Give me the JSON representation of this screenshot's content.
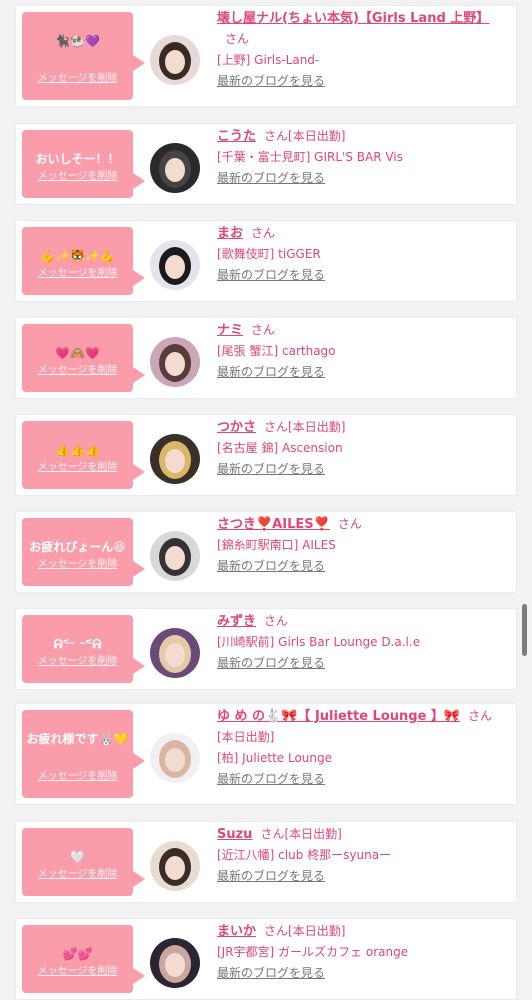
{
  "delete_label": "メッセージを削除",
  "san_label": "さん",
  "blog_label": "最新のブログを見る",
  "colors": {
    "bubble": "#fb9cab",
    "name": "#e0457b",
    "blog": "#777777",
    "background": "#f2f2f4"
  },
  "entries": [
    {
      "message": "🐈‍⬛🐏💜",
      "name": "壊し屋ナル(ちょい本気)【Girls Land 上野】",
      "status": "",
      "shop": "[上野] Girls-Land-",
      "avatar_icon": "girl-photo-icon"
    },
    {
      "message": "おいしそー！！",
      "name": "こうた",
      "status": "[本日出勤]",
      "shop": "[千葉・富士見町] GIRL'S BAR Vis",
      "avatar_icon": "dark-photo-icon"
    },
    {
      "message": "💪✨🐯✨💪",
      "name": "まお",
      "status": "",
      "shop": "[歌舞伎町] tiGGER",
      "avatar_icon": "girl-photo-icon"
    },
    {
      "message": "💗🙈💗",
      "name": "ナミ",
      "status": "",
      "shop": "[尾張 蟹江] carthago",
      "avatar_icon": "girl-photo-icon"
    },
    {
      "message": "👍👍👍",
      "name": "つかさ",
      "status": "[本日出勤]",
      "shop": "[名古屋 錦] Ascension",
      "avatar_icon": "girl-photo-icon"
    },
    {
      "message": "お疲れぴょーん😆",
      "name": "さつき❣️AILES❣️",
      "status": "",
      "shop": "[錦糸町駅南口] AILES",
      "avatar_icon": "girl-photo-icon"
    },
    {
      "message": "ᕱᑉᵕ ᵕᑉᕱ",
      "name": "みずき",
      "status": "",
      "shop": "[川崎駅前] Girls Bar Lounge D.a.l.e",
      "avatar_icon": "girl-photo-icon"
    },
    {
      "message": "お疲れ様です🐰💛",
      "name": "ゆ め の🐇🎀【 Juliette Lounge 】🎀",
      "status": "[本日出勤]",
      "shop": "[柏] Juliette Lounge",
      "avatar_icon": "girl-photo-icon"
    },
    {
      "message": "🤍",
      "name": "Suzu",
      "status": "[本日出勤]",
      "shop": "[近江八幡] club 柊那ーsyunaー",
      "avatar_icon": "girl-photo-icon"
    },
    {
      "message": "💕💕",
      "name": "まいか",
      "status": "[本日出勤]",
      "shop": "[JR宇都宮] ガールズカフェ orange",
      "avatar_icon": "girl-photo-icon"
    }
  ]
}
